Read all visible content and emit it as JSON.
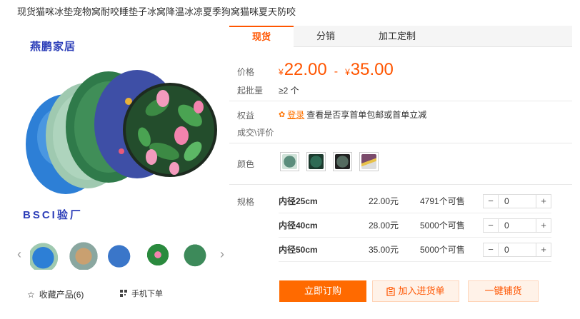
{
  "product": {
    "title": "现货猫咪冰垫宠物窝耐咬睡垫子冰窝降温冰凉夏季狗窝猫咪夏天防咬"
  },
  "gallery": {
    "brand_top": "燕鹏家居",
    "brand_bottom": "BSCI验厂",
    "thumbnails": [
      {
        "name": "thumb-1",
        "color": "#2d7fd6"
      },
      {
        "name": "thumb-2",
        "color": "#8aa7a0"
      },
      {
        "name": "thumb-3",
        "color": "#3a76c9"
      },
      {
        "name": "thumb-4",
        "color": "#2a8a3e"
      },
      {
        "name": "thumb-5",
        "color": "#3d8a5a"
      }
    ],
    "favorite_label": "收藏产品(6)",
    "mobile_order_label": "手机下单"
  },
  "tabs": [
    {
      "label": "现货",
      "active": true
    },
    {
      "label": "分销",
      "active": false
    },
    {
      "label": "加工定制",
      "active": false
    }
  ],
  "price": {
    "label": "价格",
    "currency": "¥",
    "min": "22.00",
    "separator": "-",
    "max": "35.00"
  },
  "moq": {
    "label": "起批量",
    "value": "≥2 个"
  },
  "benefit": {
    "label": "权益",
    "login": "登录",
    "text": "查看是否享首单包邮或首单立减"
  },
  "review": {
    "label": "成交\\评价"
  },
  "color": {
    "label": "颜色",
    "options": [
      "#5b8d7c",
      "#2f6b55",
      "#556b60",
      "#7a4a6a"
    ]
  },
  "spec": {
    "label": "规格",
    "rows": [
      {
        "name": "内径25cm",
        "price": "22.00元",
        "stock": "4791个可售",
        "qty": "0"
      },
      {
        "name": "内径40cm",
        "price": "28.00元",
        "stock": "5000个可售",
        "qty": "0"
      },
      {
        "name": "内径50cm",
        "price": "35.00元",
        "stock": "5000个可售",
        "qty": "0"
      }
    ]
  },
  "actions": {
    "buy_now": "立即订购",
    "add_to_list": "加入进货单",
    "one_click": "一键铺货"
  },
  "colors": {
    "accent": "#ff5500",
    "brand_text": "#2b3db8"
  }
}
